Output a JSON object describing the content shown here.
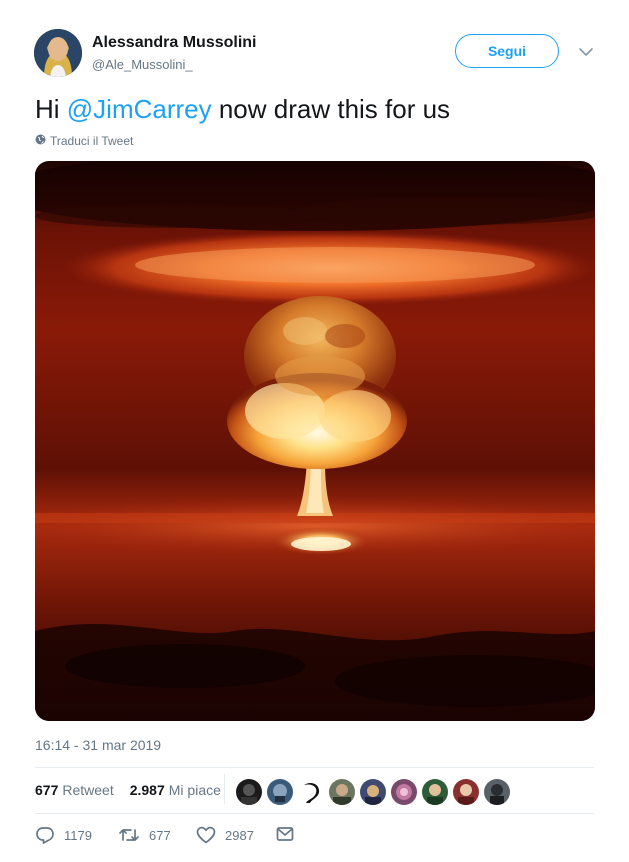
{
  "author": {
    "name": "Alessandra Mussolini",
    "handle": "@Ale_Mussolini_"
  },
  "follow_button": {
    "label": "Segui"
  },
  "tweet": {
    "text_before": "Hi ",
    "mention": "@JimCarrey",
    "text_after": " now draw this for us",
    "translate_label": "Traduci il Tweet",
    "timestamp": "16:14 - 31 mar 2019"
  },
  "stats": {
    "retweets_count": "677",
    "retweets_label": "Retweet",
    "likes_count": "2.987",
    "likes_label": "Mi piace"
  },
  "actions": {
    "reply_count": "1179",
    "retweet_count": "677",
    "like_count": "2987"
  },
  "colors": {
    "accent": "#1da1f2",
    "secondary_text": "#657786",
    "divider": "#e6ecf0"
  },
  "icons": [
    "globe-icon",
    "chevron-down-icon",
    "reply-icon",
    "retweet-icon",
    "heart-icon",
    "envelope-icon"
  ]
}
